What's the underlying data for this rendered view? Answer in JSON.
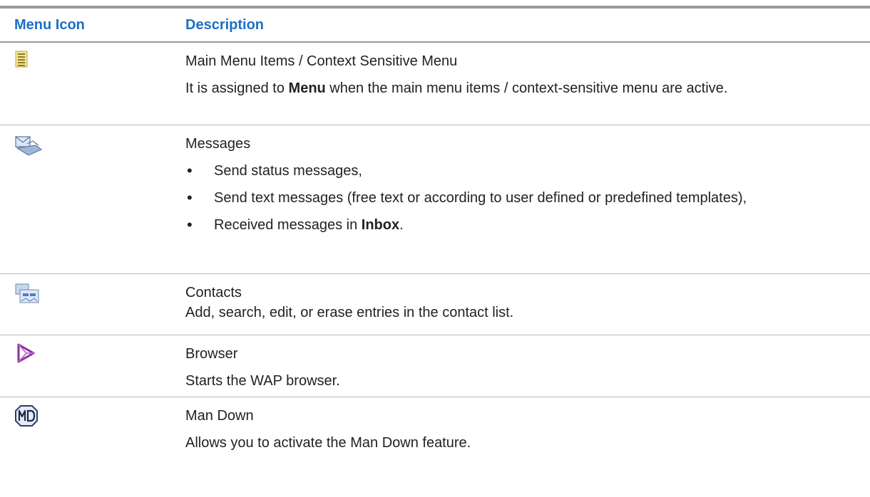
{
  "header": {
    "col1": "Menu Icon",
    "col2": "Description"
  },
  "rows": [
    {
      "icon": "main-menu-icon",
      "title": "Main Menu Items / Context Sensitive Menu",
      "para_pre": "It is assigned to ",
      "para_bold": "Menu",
      "para_post": " when the main menu items / context-sensitive menu are active."
    },
    {
      "icon": "messages-icon",
      "title": "Messages",
      "bullets": [
        "Send status messages,",
        "Send text messages (free text or according to user defined or predefined templates),"
      ],
      "bullet3_pre": "Received messages in ",
      "bullet3_bold": "Inbox",
      "bullet3_post": "."
    },
    {
      "icon": "contacts-icon",
      "title": "Contacts",
      "line2": "Add, search, edit, or erase entries in the contact list."
    },
    {
      "icon": "browser-icon",
      "title": "Browser",
      "para": "Starts the WAP browser."
    },
    {
      "icon": "man-down-icon",
      "title": "Man Down",
      "para": "Allows you to activate the Man Down feature."
    }
  ],
  "colors": {
    "header_text": "#1d6fc4",
    "rule": "#9a9a9a"
  }
}
